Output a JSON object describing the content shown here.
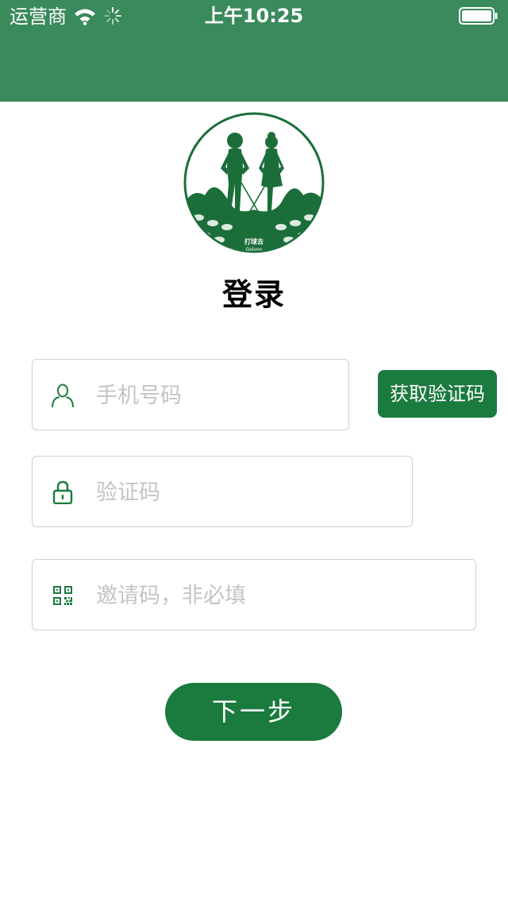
{
  "status_bar": {
    "carrier": "运营商",
    "time": "上午10:25"
  },
  "logo": {
    "text_cn": "打球去",
    "text_en": "Golvon"
  },
  "page_title": "登录",
  "form": {
    "phone_placeholder": "手机号码",
    "get_code_label": "获取验证码",
    "code_placeholder": "验证码",
    "invite_placeholder": "邀请码，非必填"
  },
  "next_label": "下一步",
  "icons": [
    "wifi-icon",
    "activity-spinner-icon",
    "battery-icon",
    "user-icon",
    "lock-icon",
    "qr-code-icon"
  ],
  "colors": {
    "header": "#3a8a5c",
    "primary": "#1b7a3e",
    "field_border": "#d0d0d0",
    "placeholder": "#c4c4c4"
  }
}
